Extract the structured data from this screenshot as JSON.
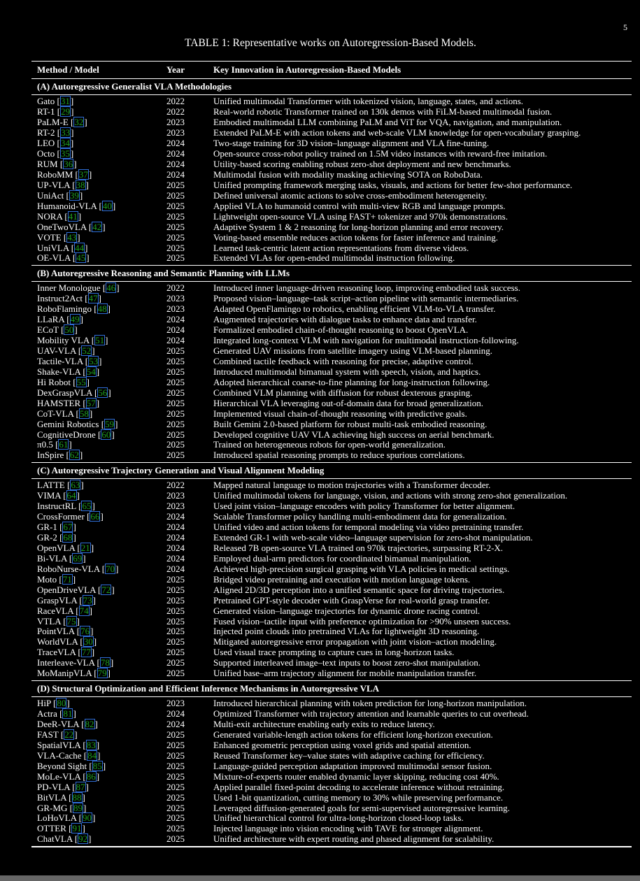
{
  "page_number": "5",
  "caption": "TABLE 1: Representative works on Autoregression-Based Models.",
  "headers": {
    "method": "Method / Model",
    "year": "Year",
    "innovation": "Key Innovation in Autoregression-Based Models"
  },
  "sections": [
    {
      "title": "(A) Autoregressive Generalist VLA Methodologies",
      "rows": [
        {
          "m": "Gato",
          "r": "31",
          "y": "2022",
          "k": "Unified multimodal Transformer with tokenized vision, language, states, and actions."
        },
        {
          "m": "RT-1",
          "r": "29",
          "y": "2022",
          "k": "Real-world robotic Transformer trained on 130k demos with FiLM-based multimodal fusion."
        },
        {
          "m": "PaLM-E",
          "r": "32",
          "y": "2023",
          "k": "Embodied multimodal LLM combining PaLM and ViT for VQA, navigation, and manipulation."
        },
        {
          "m": "RT-2",
          "r": "33",
          "y": "2023",
          "k": "Extended PaLM-E with action tokens and web-scale VLM knowledge for open-vocabulary grasping."
        },
        {
          "m": "LEO",
          "r": "34",
          "y": "2024",
          "k": "Two-stage training for 3D vision–language alignment and VLA fine-tuning."
        },
        {
          "m": "Octo",
          "r": "35",
          "y": "2024",
          "k": "Open-source cross-robot policy trained on 1.5M video instances with reward-free imitation."
        },
        {
          "m": "RUM",
          "r": "36",
          "y": "2024",
          "k": "Utility-based scoring enabling robust zero-shot deployment and new benchmarks."
        },
        {
          "m": "RoboMM",
          "r": "37",
          "y": "2024",
          "k": "Multimodal fusion with modality masking achieving SOTA on RoboData."
        },
        {
          "m": "UP-VLA",
          "r": "38",
          "y": "2025",
          "k": "Unified prompting framework merging tasks, visuals, and actions for better few-shot performance."
        },
        {
          "m": "UniAct",
          "r": "39",
          "y": "2025",
          "k": "Defined universal atomic actions to solve cross-embodiment heterogeneity."
        },
        {
          "m": "Humanoid-VLA",
          "r": "40",
          "y": "2025",
          "k": "Applied VLA to humanoid control with multi-view RGB and language prompts."
        },
        {
          "m": "NORA",
          "r": "41",
          "y": "2025",
          "k": "Lightweight open-source VLA using FAST+ tokenizer and 970k demonstrations."
        },
        {
          "m": "OneTwoVLA",
          "r": "42",
          "y": "2025",
          "k": "Adaptive System 1 & 2 reasoning for long-horizon planning and error recovery."
        },
        {
          "m": "VOTE",
          "r": "43",
          "y": "2025",
          "k": "Voting-based ensemble reduces action tokens for faster inference and training."
        },
        {
          "m": "UniVLA",
          "r": "44",
          "y": "2025",
          "k": "Learned task-centric latent action representations from diverse videos."
        },
        {
          "m": "OE-VLA",
          "r": "45",
          "y": "2025",
          "k": "Extended VLAs for open-ended multimodal instruction following."
        }
      ]
    },
    {
      "title": "(B) Autoregressive Reasoning and Semantic Planning with LLMs",
      "rows": [
        {
          "m": "Inner Monologue",
          "r": "46",
          "y": "2022",
          "k": "Introduced inner language-driven reasoning loop, improving embodied task success."
        },
        {
          "m": "Instruct2Act",
          "r": "47",
          "y": "2023",
          "k": "Proposed vision–language–task script–action pipeline with semantic intermediaries."
        },
        {
          "m": "RoboFlamingo",
          "r": "48",
          "y": "2023",
          "k": "Adapted OpenFlamingo to robotics, enabling efficient VLM-to-VLA transfer."
        },
        {
          "m": "LLaRA",
          "r": "49",
          "y": "2024",
          "k": "Augmented trajectories with dialogue tasks to enhance data and transfer."
        },
        {
          "m": "ECoT",
          "r": "50",
          "y": "2024",
          "k": "Formalized embodied chain-of-thought reasoning to boost OpenVLA."
        },
        {
          "m": "Mobility VLA",
          "r": "51",
          "y": "2024",
          "k": "Integrated long-context VLM with navigation for multimodal instruction-following."
        },
        {
          "m": "UAV-VLA",
          "r": "52",
          "y": "2025",
          "k": "Generated UAV missions from satellite imagery using VLM-based planning."
        },
        {
          "m": "Tactile-VLA",
          "r": "53",
          "y": "2025",
          "k": "Combined tactile feedback with reasoning for precise, adaptive control."
        },
        {
          "m": "Shake-VLA",
          "r": "54",
          "y": "2025",
          "k": "Introduced multimodal bimanual system with speech, vision, and haptics."
        },
        {
          "m": "Hi Robot",
          "r": "55",
          "y": "2025",
          "k": "Adopted hierarchical coarse-to-fine planning for long-instruction following."
        },
        {
          "m": "DexGraspVLA",
          "r": "56",
          "y": "2025",
          "k": "Combined VLM planning with diffusion for robust dexterous grasping."
        },
        {
          "m": "HAMSTER",
          "r": "57",
          "y": "2025",
          "k": "Hierarchical VLA leveraging out-of-domain data for broad generalization."
        },
        {
          "m": "CoT-VLA",
          "r": "58",
          "y": "2025",
          "k": "Implemented visual chain-of-thought reasoning with predictive goals."
        },
        {
          "m": "Gemini Robotics",
          "r": "59",
          "y": "2025",
          "k": "Built Gemini 2.0-based platform for robust multi-task embodied reasoning."
        },
        {
          "m": "CognitiveDrone",
          "r": "60",
          "y": "2025",
          "k": "Developed cognitive UAV VLA achieving high success on aerial benchmark."
        },
        {
          "m": "π0.5",
          "r": "61",
          "y": "2025",
          "k": "Trained on heterogeneous robots for open-world generalization."
        },
        {
          "m": "InSpire",
          "r": "62",
          "y": "2025",
          "k": "Introduced spatial reasoning prompts to reduce spurious correlations."
        }
      ]
    },
    {
      "title": "(C) Autoregressive Trajectory Generation and Visual Alignment Modeling",
      "rows": [
        {
          "m": "LATTE",
          "r": "63",
          "y": "2022",
          "k": "Mapped natural language to motion trajectories with a Transformer decoder."
        },
        {
          "m": "VIMA",
          "r": "64",
          "y": "2023",
          "k": "Unified multimodal tokens for language, vision, and actions with strong zero-shot generalization."
        },
        {
          "m": "InstructRL",
          "r": "65",
          "y": "2023",
          "k": "Used joint vision–language encoders with policy Transformer for better alignment."
        },
        {
          "m": "CrossFormer",
          "r": "66",
          "y": "2024",
          "k": "Scalable Transformer policy handling multi-embodiment data for generalization."
        },
        {
          "m": "GR-1",
          "r": "67",
          "y": "2024",
          "k": "Unified video and action tokens for temporal modeling via video pretraining transfer."
        },
        {
          "m": "GR-2",
          "r": "68",
          "y": "2024",
          "k": "Extended GR-1 with web-scale video–language supervision for zero-shot manipulation."
        },
        {
          "m": "OpenVLA",
          "r": "21",
          "y": "2024",
          "k": "Released 7B open-source VLA trained on 970k trajectories, surpassing RT-2-X."
        },
        {
          "m": "Bi-VLA",
          "r": "69",
          "y": "2024",
          "k": "Employed dual-arm predictors for coordinated bimanual manipulation."
        },
        {
          "m": "RoboNurse-VLA",
          "r": "70",
          "y": "2024",
          "k": "Achieved high-precision surgical grasping with VLA policies in medical settings."
        },
        {
          "m": "Moto",
          "r": "71",
          "y": "2025",
          "k": "Bridged video pretraining and execution with motion language tokens."
        },
        {
          "m": "OpenDriveVLA",
          "r": "72",
          "y": "2025",
          "k": "Aligned 2D/3D perception into a unified semantic space for driving trajectories."
        },
        {
          "m": "GraspVLA",
          "r": "73",
          "y": "2025",
          "k": "Pretrained GPT-style decoder with GraspVerse for real-world grasp transfer."
        },
        {
          "m": "RaceVLA",
          "r": "74",
          "y": "2025",
          "k": "Generated vision–language trajectories for dynamic drone racing control."
        },
        {
          "m": "VTLA",
          "r": "75",
          "y": "2025",
          "k": "Fused vision–tactile input with preference optimization for >90% unseen success."
        },
        {
          "m": "PointVLA",
          "r": "76",
          "y": "2025",
          "k": "Injected point clouds into pretrained VLAs for lightweight 3D reasoning."
        },
        {
          "m": "WorldVLA",
          "r": "30",
          "y": "2025",
          "k": "Mitigated autoregressive error propagation with joint vision–action modeling."
        },
        {
          "m": "TraceVLA",
          "r": "77",
          "y": "2025",
          "k": "Used visual trace prompting to capture cues in long-horizon tasks."
        },
        {
          "m": "Interleave-VLA",
          "r": "78",
          "y": "2025",
          "k": "Supported interleaved image–text inputs to boost zero-shot manipulation."
        },
        {
          "m": "MoManipVLA",
          "r": "79",
          "y": "2025",
          "k": "Unified base–arm trajectory alignment for mobile manipulation transfer."
        }
      ]
    },
    {
      "title": "(D) Structural Optimization and Efficient Inference Mechanisms in Autoregressive VLA",
      "rows": [
        {
          "m": "HiP",
          "r": "80",
          "y": "2023",
          "k": "Introduced hierarchical planning with token prediction for long-horizon manipulation."
        },
        {
          "m": "Actra",
          "r": "81",
          "y": "2024",
          "k": "Optimized Transformer with trajectory attention and learnable queries to cut overhead."
        },
        {
          "m": "DeeR-VLA",
          "r": "82",
          "y": "2024",
          "k": "Multi-exit architecture enabling early exits to reduce latency."
        },
        {
          "m": "FAST",
          "r": "22",
          "y": "2025",
          "k": "Generated variable-length action tokens for efficient long-horizon execution."
        },
        {
          "m": "SpatialVLA",
          "r": "83",
          "y": "2025",
          "k": "Enhanced geometric perception using voxel grids and spatial attention."
        },
        {
          "m": "VLA-Cache",
          "r": "84",
          "y": "2025",
          "k": "Reused Transformer key–value states with adaptive caching for efficiency."
        },
        {
          "m": "Beyond Sight",
          "r": "85",
          "y": "2025",
          "k": "Language-guided perception adaptation improved multimodal sensor fusion."
        },
        {
          "m": "MoLe-VLA",
          "r": "86",
          "y": "2025",
          "k": "Mixture-of-experts router enabled dynamic layer skipping, reducing cost  40%."
        },
        {
          "m": "PD-VLA",
          "r": "87",
          "y": "2025",
          "k": "Applied parallel fixed-point decoding to accelerate inference without retraining."
        },
        {
          "m": "BitVLA",
          "r": "88",
          "y": "2025",
          "k": "Used 1-bit quantization, cutting memory to 30% while preserving performance."
        },
        {
          "m": "GR-MG",
          "r": "89",
          "y": "2025",
          "k": "Leveraged diffusion-generated goals for semi-supervised autoregressive learning."
        },
        {
          "m": "LoHoVLA",
          "r": "90",
          "y": "2025",
          "k": "Unified hierarchical control for ultra-long-horizon closed-loop tasks."
        },
        {
          "m": "OTTER",
          "r": "91",
          "y": "2025",
          "k": "Injected language into vision encoding with TAVE for stronger alignment."
        },
        {
          "m": "ChatVLA",
          "r": "92",
          "y": "2025",
          "k": "Unified architecture with expert routing and phased alignment for scalability."
        }
      ]
    }
  ]
}
